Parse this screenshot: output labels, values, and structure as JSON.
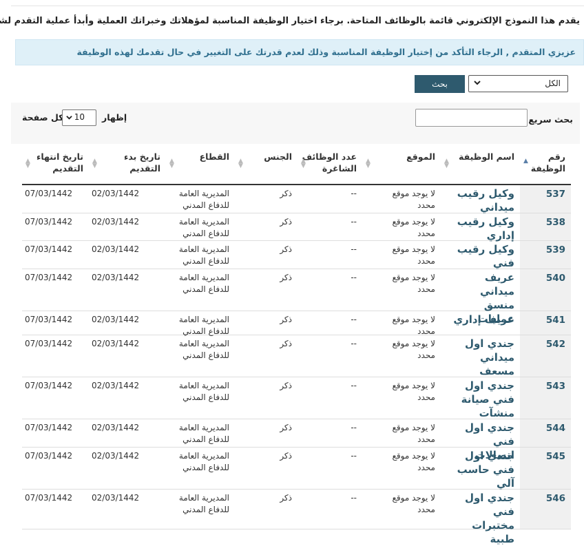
{
  "intro_text": "يقدم هذا النموذج الإلكتروني قائمة بالوظائف المتاحة. برجاء اختيار الوظيفة المناسبة لمؤهلاتك وخبراتك العملية وأبدأ عملية التقدم لشغلها.",
  "notice_text": "عزيزي المتقدم , الرجاء التأكد من إختيار الوظيفة المناسبة وذلك لعدم قدرتك على التغيير في حال تقدمك لهذه الوظيفة",
  "filter": {
    "selected": "الكل",
    "search_button": "بحث"
  },
  "table_controls": {
    "quick_search_label": "بحث سريع :",
    "show_label": "إظهار",
    "page_length": "10",
    "per_page_label": "لكل صفحة"
  },
  "columns": [
    "رقم الوظيفة",
    "اسم الوظيفة",
    "الموقع",
    "عدد الوظائف الشاغرة",
    "الجنس",
    "القطاع",
    "تاريخ بدء التقديم",
    "تاريخ انتهاء التقديم"
  ],
  "rows": [
    {
      "num": "537",
      "title": "وكيل رقيب ميداني",
      "location": "لا يوجد موقع محدد",
      "vacancies": "--",
      "gender": "ذكر",
      "sector": "المديرية العامة للدفاع المدني",
      "start": "02/03/1442",
      "end": "07/03/1442"
    },
    {
      "num": "538",
      "title": "وكيل رقيب إداري",
      "location": "لا يوجد موقع محدد",
      "vacancies": "--",
      "gender": "ذكر",
      "sector": "المديرية العامة للدفاع المدني",
      "start": "02/03/1442",
      "end": "07/03/1442"
    },
    {
      "num": "539",
      "title": "وكيل رقيب فني",
      "location": "لا يوجد موقع محدد",
      "vacancies": "--",
      "gender": "ذكر",
      "sector": "المديرية العامة للدفاع المدني",
      "start": "02/03/1442",
      "end": "07/03/1442"
    },
    {
      "num": "540",
      "title": "عريف ميداني منسق عمليات",
      "location": "لا يوجد موقع محدد",
      "vacancies": "--",
      "gender": "ذكر",
      "sector": "المديرية العامة للدفاع المدني",
      "start": "02/03/1442",
      "end": "07/03/1442"
    },
    {
      "num": "541",
      "title": "عريف إداري",
      "location": "لا يوجد موقع محدد",
      "vacancies": "--",
      "gender": "ذكر",
      "sector": "المديرية العامة للدفاع المدني",
      "start": "02/03/1442",
      "end": "07/03/1442"
    },
    {
      "num": "542",
      "title": "جندي اول ميداني مسعف",
      "location": "لا يوجد موقع محدد",
      "vacancies": "--",
      "gender": "ذكر",
      "sector": "المديرية العامة للدفاع المدني",
      "start": "02/03/1442",
      "end": "07/03/1442"
    },
    {
      "num": "543",
      "title": "جندي اول فني صيانة منشآت",
      "location": "لا يوجد موقع محدد",
      "vacancies": "--",
      "gender": "ذكر",
      "sector": "المديرية العامة للدفاع المدني",
      "start": "02/03/1442",
      "end": "07/03/1442"
    },
    {
      "num": "544",
      "title": "جندي اول فني اتصالات",
      "location": "لا يوجد موقع محدد",
      "vacancies": "--",
      "gender": "ذكر",
      "sector": "المديرية العامة للدفاع المدني",
      "start": "02/03/1442",
      "end": "07/03/1442"
    },
    {
      "num": "545",
      "title": "جندي اول فني حاسب آلي",
      "location": "لا يوجد موقع محدد",
      "vacancies": "--",
      "gender": "ذكر",
      "sector": "المديرية العامة للدفاع المدني",
      "start": "02/03/1442",
      "end": "07/03/1442"
    },
    {
      "num": "546",
      "title": "جندي اول فني مختبرات طبية",
      "location": "لا يوجد موقع محدد",
      "vacancies": "--",
      "gender": "ذكر",
      "sector": "المديرية العامة للدفاع المدني",
      "start": "02/03/1442",
      "end": "07/03/1442"
    }
  ],
  "colors": {
    "accent": "#2e5a6e",
    "notice_bg": "#dff0f8",
    "notice_text": "#31708f"
  },
  "icons": {
    "sort": "sort-arrows-icon",
    "dropdown": "chevron-down-icon"
  }
}
